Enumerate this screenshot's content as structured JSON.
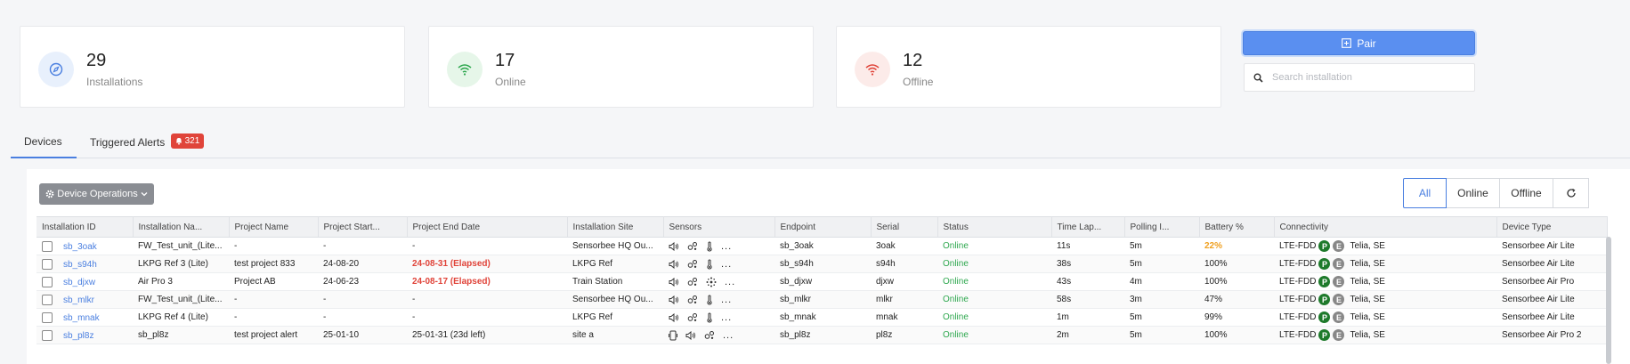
{
  "colors": {
    "accent": "#4a7fe0",
    "online": "#2fa84f",
    "offline": "#e0443a",
    "warning": "#f0a020"
  },
  "stats": [
    {
      "count": "29",
      "label": "Installations",
      "icon": "compass-icon",
      "bg": "#e8f0fc",
      "color": "#4a7fe0"
    },
    {
      "count": "17",
      "label": "Online",
      "icon": "wifi-icon",
      "bg": "#e6f6e9",
      "color": "#2fa84f"
    },
    {
      "count": "12",
      "label": "Offline",
      "icon": "wifi-off-icon",
      "bg": "#fcebe9",
      "color": "#e0443a"
    }
  ],
  "toolbar": {
    "pair_label": "Pair",
    "search_placeholder": "Search installation"
  },
  "tabs": {
    "devices": "Devices",
    "alerts": "Triggered Alerts",
    "alerts_count": "321"
  },
  "panel": {
    "device_ops_label": "Device Operations",
    "filters": [
      "All",
      "Online",
      "Offline"
    ]
  },
  "table": {
    "headers": [
      "Installation ID",
      "Installation Na...",
      "Project Name",
      "Project Start...",
      "Project End Date",
      "Installation Site",
      "Sensors",
      "Endpoint",
      "Serial",
      "Status",
      "Time Lap...",
      "Polling I...",
      "Battery %",
      "Connectivity",
      "Device Type"
    ],
    "rows": [
      {
        "id": "sb_3oak",
        "name": "FW_Test_unit_(Lite...",
        "project": "-",
        "start": "-",
        "end": "-",
        "end_style": "",
        "site": "Sensorbee HQ Ou...",
        "sensors": [
          "sound",
          "gas",
          "temp",
          "more"
        ],
        "endpoint": "sb_3oak",
        "serial": "3oak",
        "status": "Online",
        "lapse": "11s",
        "poll": "5m",
        "battery": "22%",
        "battery_style": "orange",
        "net": "LTE-FDD",
        "carrier": "Telia, SE",
        "type": "Sensorbee Air Lite"
      },
      {
        "id": "sb_s94h",
        "name": "LKPG Ref 3 (Lite)",
        "project": "test project 833",
        "start": "24-08-20",
        "end": "24-08-31 (Elapsed)",
        "end_style": "red",
        "site": "LKPG Ref",
        "sensors": [
          "sound",
          "gas",
          "temp",
          "more"
        ],
        "endpoint": "sb_s94h",
        "serial": "s94h",
        "status": "Online",
        "lapse": "38s",
        "poll": "5m",
        "battery": "100%",
        "battery_style": "",
        "net": "LTE-FDD",
        "carrier": "Telia, SE",
        "type": "Sensorbee Air Lite"
      },
      {
        "id": "sb_djxw",
        "name": "Air Pro 3",
        "project": "Project AB",
        "start": "24-06-23",
        "end": "24-08-17 (Elapsed)",
        "end_style": "red",
        "site": "Train Station",
        "sensors": [
          "sound",
          "gas",
          "particle",
          "more"
        ],
        "endpoint": "sb_djxw",
        "serial": "djxw",
        "status": "Online",
        "lapse": "43s",
        "poll": "4m",
        "battery": "100%",
        "battery_style": "",
        "net": "LTE-FDD",
        "carrier": "Telia, SE",
        "type": "Sensorbee Air Pro"
      },
      {
        "id": "sb_mlkr",
        "name": "FW_Test_unit_(Lite...",
        "project": "-",
        "start": "-",
        "end": "-",
        "end_style": "",
        "site": "Sensorbee HQ Ou...",
        "sensors": [
          "sound",
          "gas",
          "temp",
          "more"
        ],
        "endpoint": "sb_mlkr",
        "serial": "mlkr",
        "status": "Online",
        "lapse": "58s",
        "poll": "3m",
        "battery": "47%",
        "battery_style": "",
        "net": "LTE-FDD",
        "carrier": "Telia, SE",
        "type": "Sensorbee Air Lite"
      },
      {
        "id": "sb_mnak",
        "name": "LKPG Ref 4 (Lite)",
        "project": "-",
        "start": "-",
        "end": "-",
        "end_style": "",
        "site": "LKPG Ref",
        "sensors": [
          "sound",
          "gas",
          "temp",
          "more"
        ],
        "endpoint": "sb_mnak",
        "serial": "mnak",
        "status": "Online",
        "lapse": "1m",
        "poll": "5m",
        "battery": "99%",
        "battery_style": "",
        "net": "LTE-FDD",
        "carrier": "Telia, SE",
        "type": "Sensorbee Air Lite"
      },
      {
        "id": "sb_pl8z",
        "name": "sb_pl8z",
        "project": "test project alert",
        "start": "25-01-10",
        "end": "25-01-31 (23d left)",
        "end_style": "",
        "site": "site a",
        "sensors": [
          "device",
          "sound",
          "gas",
          "more"
        ],
        "endpoint": "sb_pl8z",
        "serial": "pl8z",
        "status": "Online",
        "lapse": "2m",
        "poll": "5m",
        "battery": "100%",
        "battery_style": "",
        "net": "LTE-FDD",
        "carrier": "Telia, SE",
        "type": "Sensorbee Air Pro 2"
      }
    ]
  }
}
